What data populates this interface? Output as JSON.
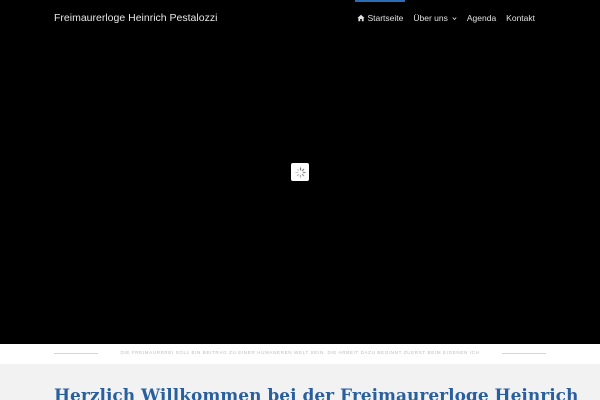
{
  "header": {
    "site_title": "Freimaurerloge Heinrich Pestalozzi"
  },
  "nav": {
    "items": [
      {
        "label": "Startseite",
        "icon": "home-icon",
        "active": true
      },
      {
        "label": "Über uns",
        "icon": "chevron-down-icon",
        "active": false
      },
      {
        "label": "Agenda",
        "active": false
      },
      {
        "label": "Kontakt",
        "active": false
      }
    ]
  },
  "hero": {
    "loader_icon": "spinner-icon"
  },
  "tagline": "DIE FREIMAUREREI SOLL EIN BEITRAG ZU EINER HUMANEREN WELT SEIN. DIE ARBEIT DAZU BEGINNT ZUERST BEIM EIGENEN ICH",
  "main": {
    "heading": "Herzlich Willkommen bei der Freimaurerloge Heinrich"
  },
  "colors": {
    "accent": "#2b6cb8",
    "heading": "#2a5f9e",
    "hero_bg": "#000000"
  }
}
